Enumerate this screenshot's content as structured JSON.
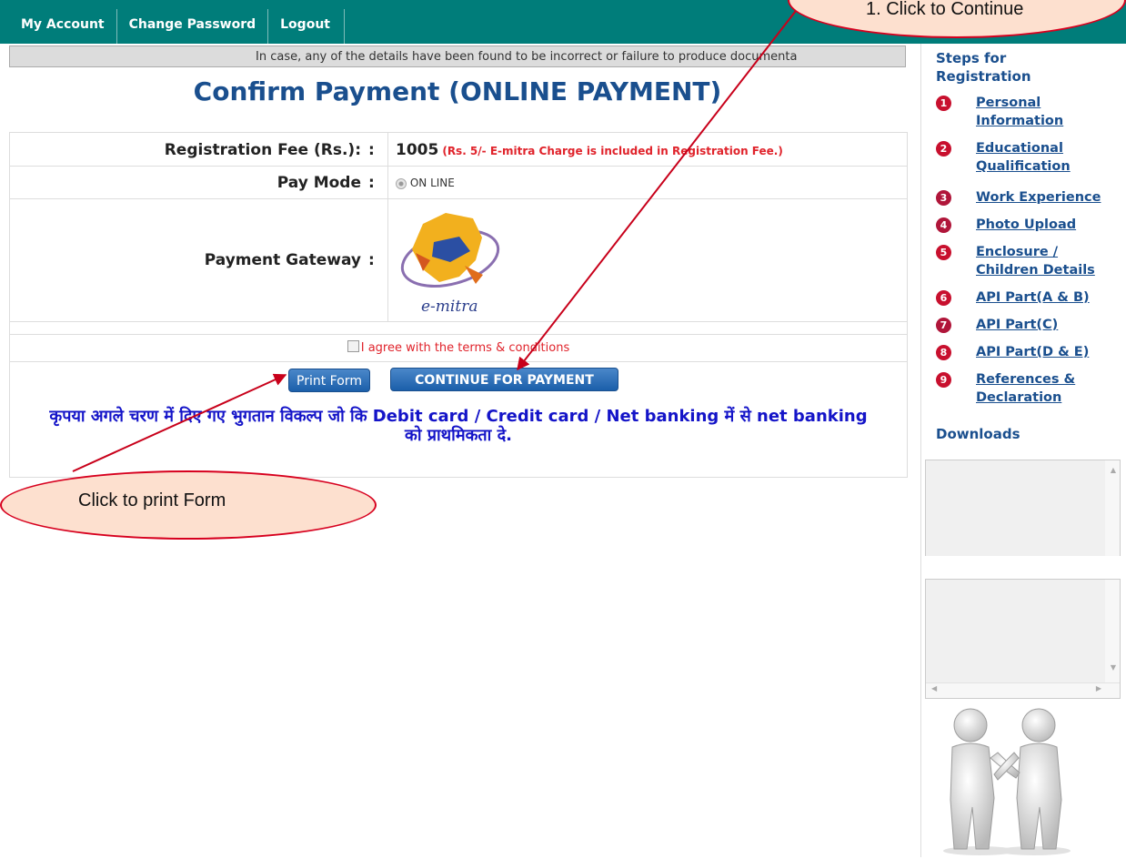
{
  "nav": {
    "items": [
      "My Account",
      "Change Password",
      "Logout"
    ]
  },
  "notice": "In case, any of the details have been found to be incorrect or failure to produce documenta",
  "page_title": "Confirm Payment (ONLINE PAYMENT)",
  "form": {
    "fee_label": "Registration Fee (Rs.):",
    "fee_value": "1005",
    "fee_note": "(Rs. 5/- E-mitra Charge is included in Registration Fee.)",
    "paymode_label": "Pay Mode",
    "paymode_option": "ON LINE",
    "gateway_label": "Payment Gateway",
    "gateway_logo_text": "e-mitra",
    "colon": ":",
    "agree_text": "I agree with the terms & conditions",
    "print_button": "Print Form",
    "continue_button": "CONTINUE FOR PAYMENT",
    "hindi_line1": "कृपया अगले चरण में दिए गए भुगतान विकल्प जो कि Debit card / Credit card / Net banking  में से net banking",
    "hindi_line2": "को प्राथमिकता दे."
  },
  "sidebar": {
    "steps_heading_1": "Steps for",
    "steps_heading_2": "Registration",
    "steps": [
      {
        "num": "1",
        "line1": "Personal",
        "line2": "Information",
        "color": "#c8102e"
      },
      {
        "num": "2",
        "line1": "Educational",
        "line2": "Qualification",
        "color": "#c8102e"
      },
      {
        "num": "3",
        "line1": "Work Experience",
        "line2": "",
        "color": "#b0163a"
      },
      {
        "num": "4",
        "line1": "Photo Upload",
        "line2": "",
        "color": "#b0163a"
      },
      {
        "num": "5",
        "line1": "Enclosure /",
        "line2": "Children Details",
        "color": "#c8102e"
      },
      {
        "num": "6",
        "line1": "API Part(A & B)",
        "line2": "",
        "color": "#c8102e"
      },
      {
        "num": "7",
        "line1": "API Part(C)",
        "line2": "",
        "color": "#b0163a"
      },
      {
        "num": "8",
        "line1": "API Part(D & E)",
        "line2": "",
        "color": "#c8102e"
      },
      {
        "num": "9",
        "line1": "References &",
        "line2": "Declaration",
        "color": "#c8102e"
      }
    ],
    "downloads_heading": "Downloads"
  },
  "annotations": {
    "top": "1. Click to Continue",
    "bottom": "Click to print Form",
    "colors": {
      "fill": "#fde0cf",
      "border": "#d7001e"
    }
  }
}
